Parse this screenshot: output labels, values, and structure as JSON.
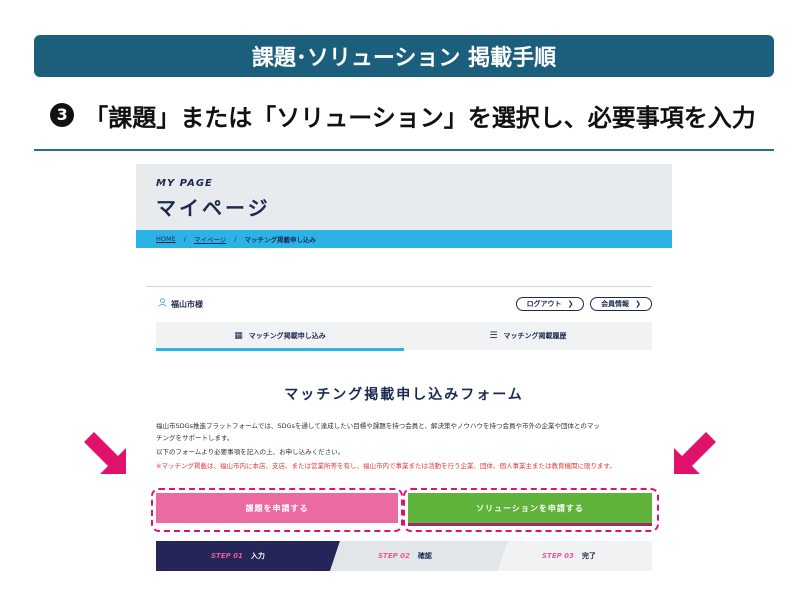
{
  "slide": {
    "banner": "課題･ソリューション 掲載手順",
    "step_number": "3",
    "step_heading": "「課題」または「ソリューション」を選択し、必要事項を入力"
  },
  "mypage": {
    "title_en": "MY PAGE",
    "title_ja": "マイページ",
    "breadcrumb": {
      "home": "HOME",
      "mypage": "マイページ",
      "current": "マッチング掲載申し込み"
    },
    "user_name": "福山市様",
    "logout_label": "ログアウト",
    "member_info_label": "会員情報",
    "tabs": [
      {
        "label": "マッチング掲載申し込み",
        "icon": "grid-icon",
        "active": true
      },
      {
        "label": "マッチング掲載履歴",
        "icon": "list-icon",
        "active": false
      }
    ],
    "form_title": "マッチング掲載申し込みフォーム",
    "description": [
      "福山市SDGs推進プラットフォームでは、SDGsを通して達成したい目標や課題を持つ会員と、解決策やノウハウを持つ会員や市外の企業や団体とのマッ",
      "チングをサポートします。",
      "以下のフォームより必要事項を記入の上、お申し込みください。"
    ],
    "note": "※マッチング掲載は、福山市内に本店、支店、または営業所等を有し、福山市内で事業または活動を行う企業、団体、個人事業主または教育機関に限ります。",
    "issue_button": "課題を申請する",
    "solution_button": "ソリューションを申請する",
    "steps": [
      {
        "num": "STEP 01",
        "label": "入力",
        "active": true
      },
      {
        "num": "STEP 02",
        "label": "確認",
        "active": false
      },
      {
        "num": "STEP 03",
        "label": "完了",
        "active": false
      }
    ]
  },
  "colors": {
    "banner": "#1c5f7c",
    "navy": "#1d2a4f",
    "breadcrumb": "#2bb3e6",
    "issue_button": "#ea6aa1",
    "solution_button": "#5fb33a",
    "highlight": "#e0126b",
    "step_pink": "#ea5a96"
  }
}
